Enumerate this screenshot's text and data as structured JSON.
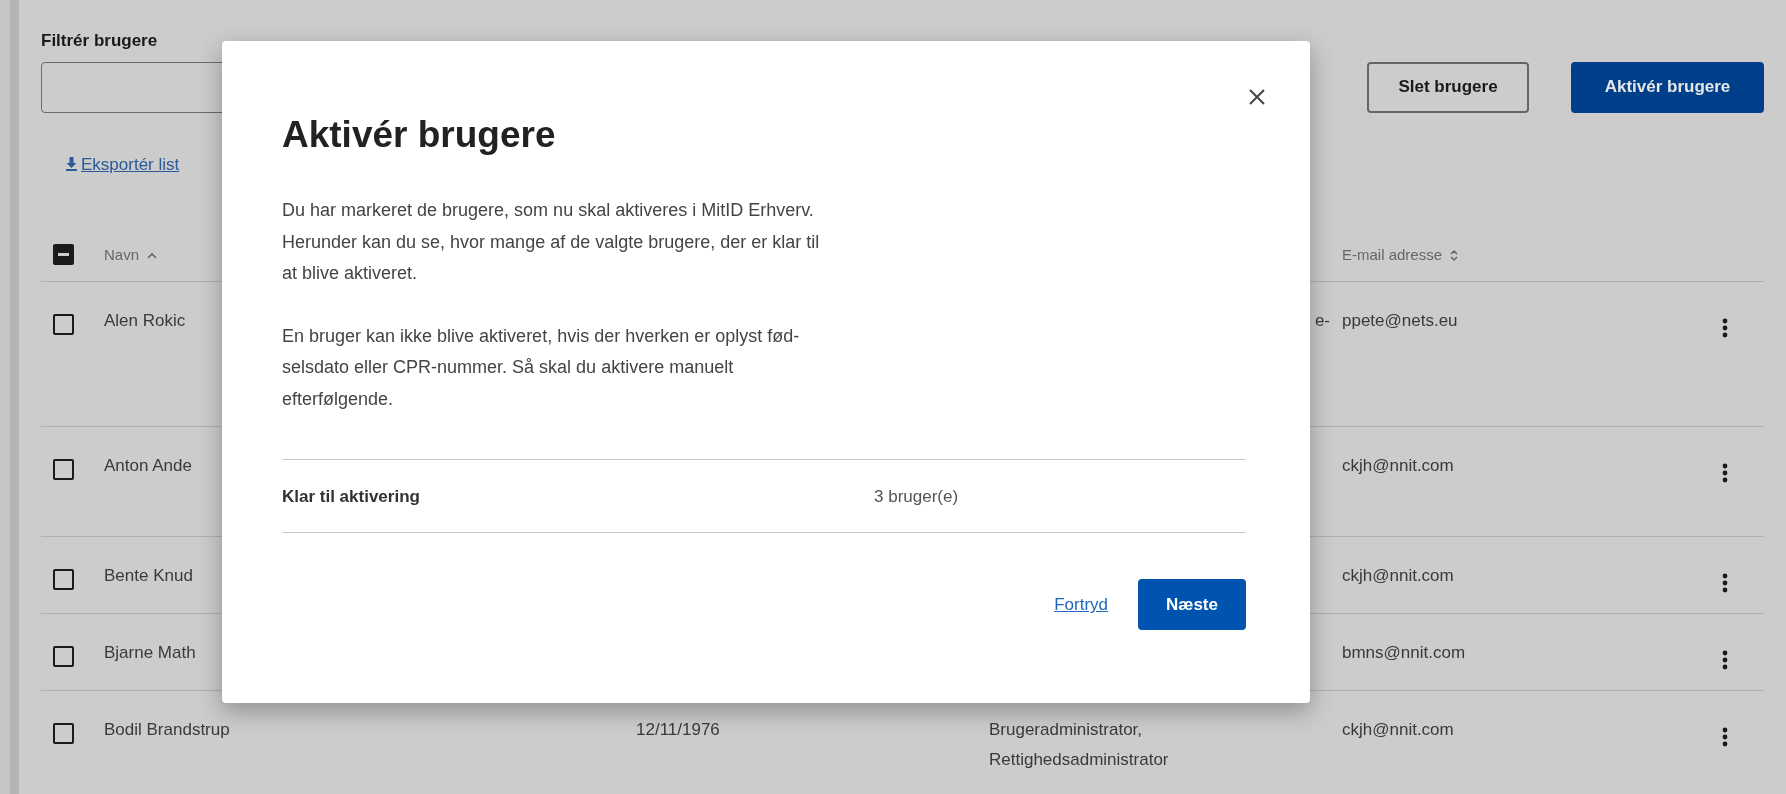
{
  "filter": {
    "label": "Filtrér brugere"
  },
  "actions": [
    {
      "label": "Slet brugere",
      "kind": "secondary"
    },
    {
      "label": "Aktivér brugere",
      "kind": "primary"
    }
  ],
  "export_link": {
    "label": "Eksportér list"
  },
  "table": {
    "header_checkbox": {
      "indeterminate": true
    },
    "columns": [
      {
        "label": "Navn",
        "sorted": true
      },
      {
        "label": "E-mail adresse",
        "sorted": false
      }
    ],
    "rows": [
      {
        "checked": false,
        "name": "Alen Rokic",
        "roles_line_end": "e-",
        "email": "ppete@nets.eu"
      },
      {
        "checked": false,
        "name": "Anton Ande",
        "email": "ckjh@nnit.com"
      },
      {
        "checked": false,
        "name": "Bente Knud",
        "email": "ckjh@nnit.com"
      },
      {
        "checked": false,
        "name": "Bjarne Math",
        "email": "bmns@nnit.com"
      },
      {
        "checked": false,
        "name": "Bodil Brandstrup",
        "birth_date": "12/11/1976",
        "roles": [
          "Brugeradministrator,",
          "Rettighedsadministrator"
        ],
        "email": "ckjh@nnit.com"
      }
    ]
  },
  "dialog": {
    "title": "Aktivér brugere",
    "paragraphs": [
      "Du har markeret de brugere, som nu skal aktiveres i MitID Erhverv.\nHerunder kan du se, hvor mange af de valgte brugere, der er klar til\nat blive aktiveret.",
      "En bruger kan ikke blive aktiveret, hvis der hverken er oplyst fød-\nselsdato eller CPR-nummer. Så skal du aktivere manuelt\nefterfølgende."
    ],
    "summary": {
      "label": "Klar til aktivering",
      "value": "3 bruger(e)"
    },
    "cancel": "Fortryd",
    "next": "Næste"
  }
}
